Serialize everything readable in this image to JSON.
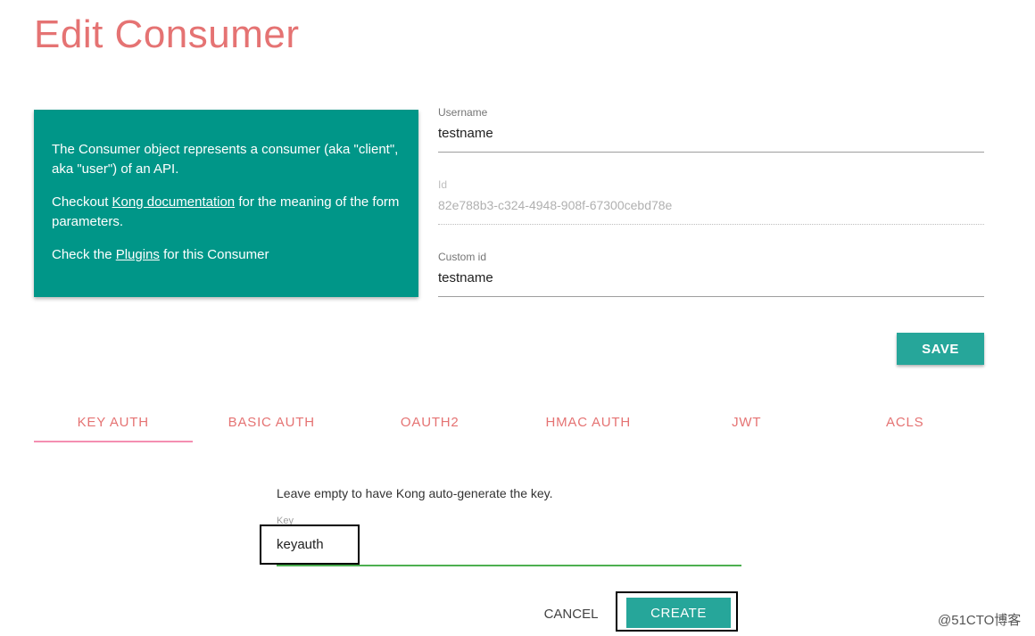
{
  "page": {
    "title": "Edit Consumer"
  },
  "info": {
    "line1": "The Consumer object represents a consumer (aka \"client\", aka \"user\") of an API.",
    "line2_prefix": "Checkout ",
    "line2_link": "Kong documentation",
    "line2_suffix": " for the meaning of the form parameters.",
    "line3_prefix": "Check the ",
    "line3_link": "Plugins",
    "line3_suffix": " for this Consumer"
  },
  "form": {
    "username": {
      "label": "Username",
      "value": "testname"
    },
    "id": {
      "label": "Id",
      "value": "82e788b3-c324-4948-908f-67300cebd78e"
    },
    "custom_id": {
      "label": "Custom id",
      "value": "testname"
    },
    "save_label": "SAVE"
  },
  "tabs": [
    {
      "label": "KEY AUTH",
      "active": true
    },
    {
      "label": "BASIC AUTH"
    },
    {
      "label": "OAUTH2"
    },
    {
      "label": "HMAC AUTH"
    },
    {
      "label": "JWT"
    },
    {
      "label": "ACLS"
    }
  ],
  "key_auth": {
    "hint": "Leave empty to have Kong auto-generate the key.",
    "key_label": "Key",
    "key_value": "keyauth",
    "cancel_label": "CANCEL",
    "create_label": "CREATE"
  },
  "watermark": "@51CTO博客",
  "colors": {
    "accent": "#009688",
    "button": "#26a69a",
    "title": "#e57373",
    "active_underline": "#4caf50"
  }
}
